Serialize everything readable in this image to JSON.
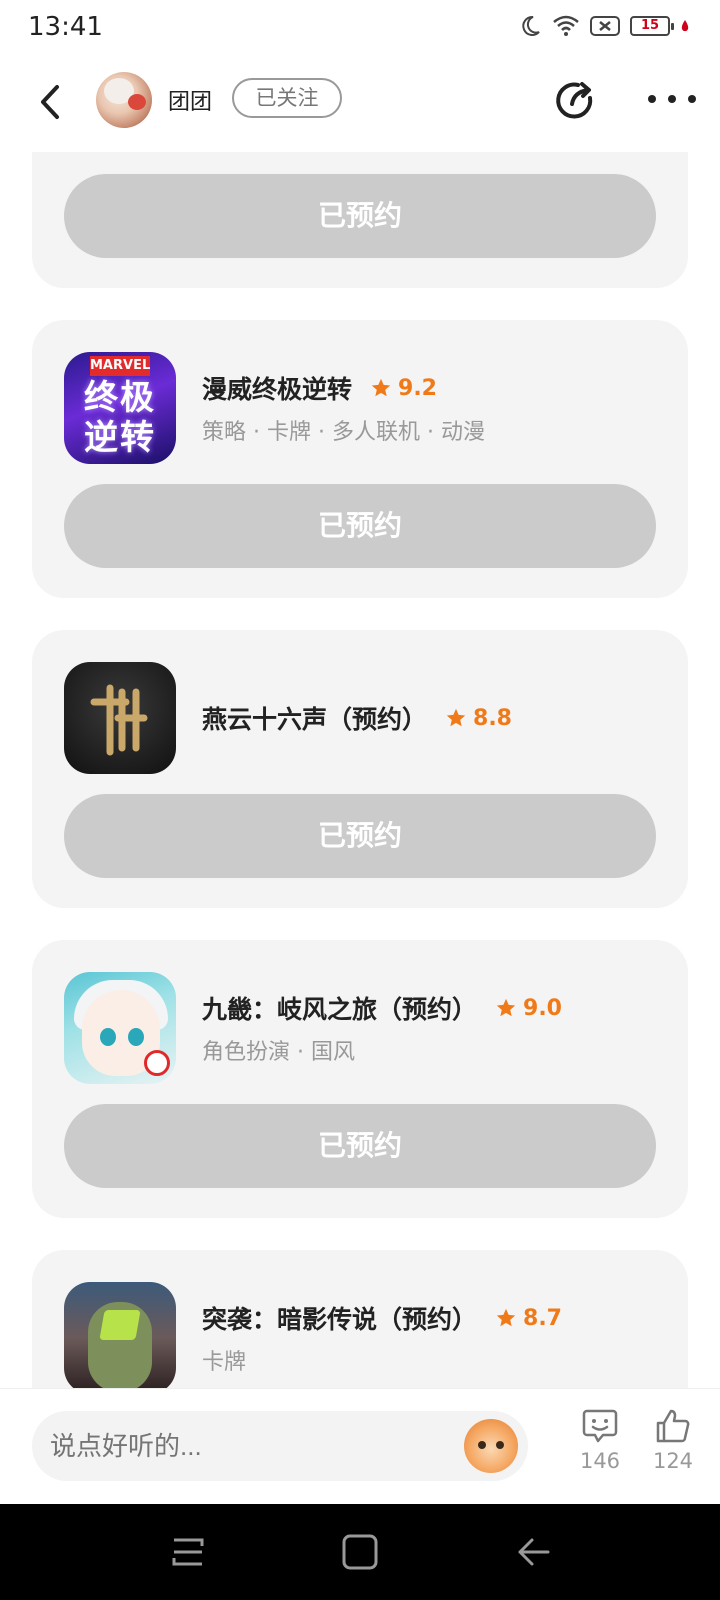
{
  "status_bar": {
    "time": "13:41",
    "battery": "15",
    "icons": [
      "moon-icon",
      "wifi-icon",
      "sim-off-icon",
      "battery-icon"
    ]
  },
  "header": {
    "user_name": "团团",
    "follow_label": "已关注",
    "icons": [
      "back-icon",
      "share-icon",
      "more-icon"
    ]
  },
  "games": [
    {
      "name": "",
      "rating": "",
      "tags": "",
      "button_label": "已预约"
    },
    {
      "name": "漫威终极逆转",
      "rating": "9.2",
      "tags": "策略 · 卡牌 · 多人联机 · 动漫",
      "button_label": "已预约",
      "icon_text": {
        "logo": "MARVEL",
        "title_line1": "终极",
        "title_line2": "逆转"
      }
    },
    {
      "name": "燕云十六声（预约）",
      "rating": "8.8",
      "tags": "",
      "button_label": "已预约"
    },
    {
      "name": "九畿：岐风之旅（预约）",
      "rating": "9.0",
      "tags": "角色扮演 · 国风",
      "button_label": "已预约"
    },
    {
      "name": "突袭：暗影传说（预约）",
      "rating": "8.7",
      "tags": "卡牌",
      "button_label": ""
    }
  ],
  "comment_bar": {
    "placeholder": "说点好听的...",
    "comment_count": "146",
    "like_count": "124"
  },
  "colors": {
    "accent_rating": "#f07a18",
    "button_reserved": "#cbcbcb",
    "card_bg": "#f4f4f4"
  }
}
